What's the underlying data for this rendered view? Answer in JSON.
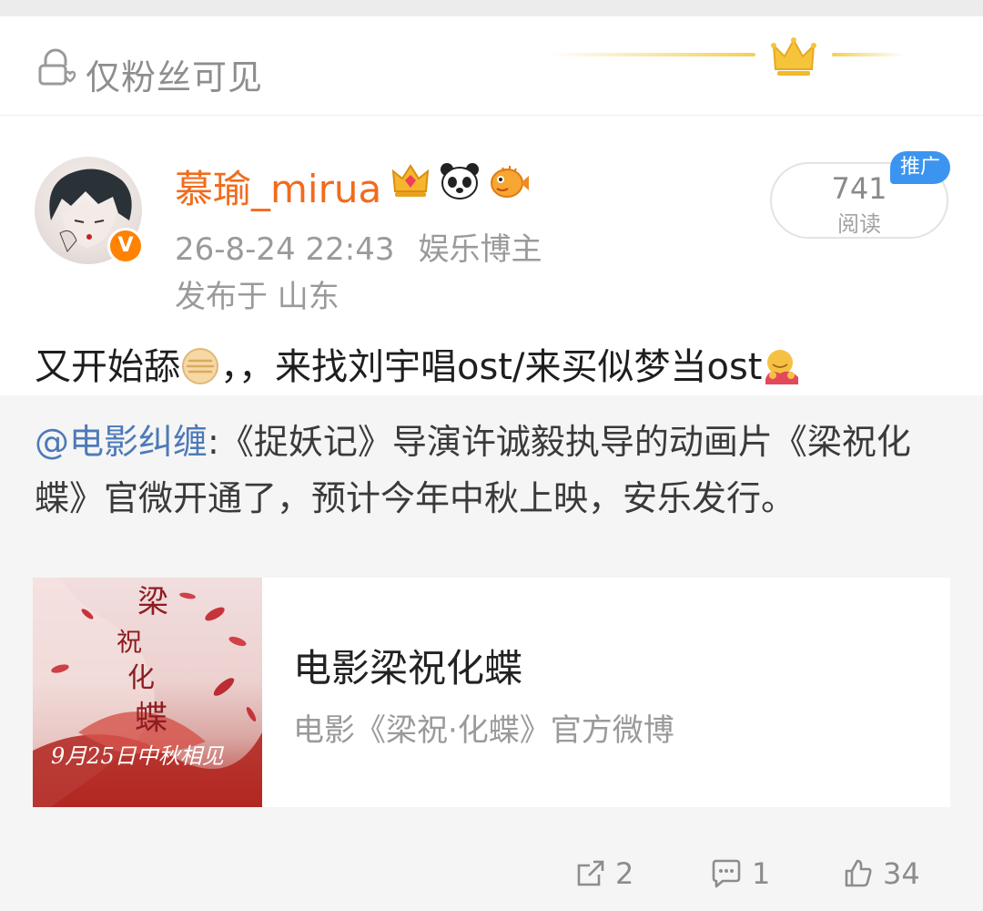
{
  "visibility": {
    "label": "仅粉丝可见",
    "lock_icon": "lock-heart-icon",
    "crown_icon": "crown-icon"
  },
  "post": {
    "author": {
      "name": "慕瑜_mirua",
      "verified_badge": "V",
      "badge_icons": [
        "crown-badge-icon",
        "panda-badge-icon",
        "puffer-fish-badge-icon"
      ]
    },
    "timestamp": "26-8-24 22:43",
    "category": "娱乐博主",
    "location": "发布于 山东",
    "reads": {
      "count": "741",
      "label": "阅读"
    },
    "promo_label": "推广",
    "text": {
      "part1": "又开始舔",
      "part2": "，，来找刘宇唱ost/来买似梦当ost"
    }
  },
  "repost": {
    "mention": "@电影纠缠",
    "text": ":《捉妖记》导演许诚毅执导的动画片《梁祝化蝶》官微开通了，预计今年中秋上映，安乐发行。",
    "card": {
      "title": "电影梁祝化蝶",
      "description": "电影《梁祝·化蝶》官方微博",
      "thumb_text": "9月25日中秋相见"
    }
  },
  "actions": {
    "share_count": "2",
    "comment_count": "1",
    "like_count": "34"
  },
  "colors": {
    "username": "#f06c1d",
    "mention": "#4d7ab8",
    "promo": "#3b95f0",
    "verified": "#ff8200"
  }
}
